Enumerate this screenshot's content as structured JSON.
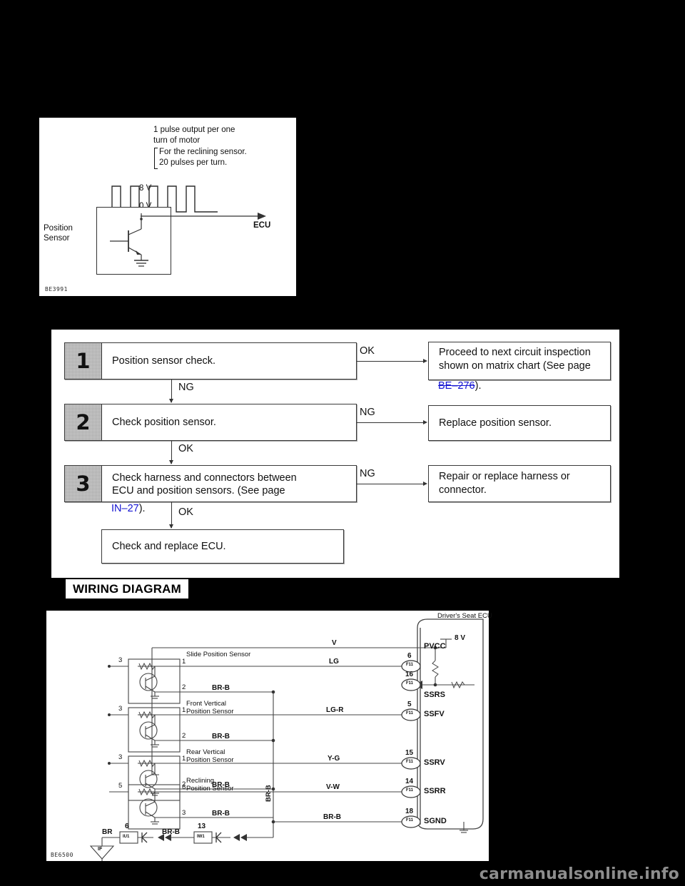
{
  "figure_top": {
    "code": "BE3991",
    "note_main": "1 pulse output per one\nturn of motor",
    "note_sub": "For the reclining sensor.\n20 pulses per turn.",
    "voltage_high": "8 V",
    "voltage_low": "0 V",
    "sensor_label": "Position\nSensor",
    "output_label": "ECU",
    "pulse_count": 5
  },
  "flowchart": {
    "steps": [
      {
        "number": "1",
        "text": "Position sensor check.",
        "branch_label": "OK",
        "down_label": "NG",
        "result": {
          "line1": "Proceed to next circuit inspection",
          "line2": "shown on matrix chart (See page",
          "link": "BE–276",
          "link_suffix": ")."
        }
      },
      {
        "number": "2",
        "text": "Check position sensor.",
        "branch_label": "NG",
        "down_label": "OK",
        "result": {
          "line1": "Replace position sensor."
        }
      },
      {
        "number": "3",
        "text_line1": "Check harness and connectors between",
        "text_line2": "ECU and position sensors.  (See page",
        "link": "IN–27",
        "link_suffix": ").",
        "branch_label": "NG",
        "down_label": "OK",
        "result": {
          "line1": "Repair or replace harness or",
          "line2": "connector."
        }
      }
    ],
    "final_box": "Check and replace ECU."
  },
  "wiring": {
    "heading": "WIRING DIAGRAM",
    "code": "BE6500",
    "ecu_title": "Driver's Seat ECU",
    "supply_label": "8 V",
    "sensors": [
      {
        "name": "Slide Position Sensor",
        "pin_left": "3",
        "pin_top": "1",
        "pin_bottom": "2",
        "ground_wire": "BR-B",
        "signal_wire": "LG"
      },
      {
        "name": "Front Vertical\nPosition Sensor",
        "pin_left": "3",
        "pin_top": "1",
        "pin_bottom": "2",
        "ground_wire": "BR-B",
        "signal_wire": "LG-R"
      },
      {
        "name": "Rear Vertical\nPosition Sensor",
        "pin_left": "3",
        "pin_top": "1",
        "pin_bottom": "2",
        "ground_wire": "BR-B",
        "signal_wire": "Y-G"
      },
      {
        "name": "Reclining\nPosition Sensor",
        "pin_left": "5",
        "pin_top": "6",
        "pin_bottom": "3",
        "ground_wire": "BR-B",
        "signal_wire": "V-W"
      }
    ],
    "ecu_pins": [
      {
        "number": "6",
        "name": "PVCC",
        "wire": "V",
        "connector": "F11"
      },
      {
        "number": "16",
        "name": "SSRS",
        "wire": "LG",
        "connector": "F11"
      },
      {
        "number": "5",
        "name": "SSFV",
        "wire": "LG-R",
        "connector": "F11"
      },
      {
        "number": "15",
        "name": "SSRV",
        "wire": "Y-G",
        "connector": "F11"
      },
      {
        "number": "14",
        "name": "SSRR",
        "wire": "V-W",
        "connector": "F11"
      },
      {
        "number": "18",
        "name": "SGND",
        "wire": "BR-B",
        "connector": "F11"
      }
    ],
    "ground_path": {
      "vertical_wire": "BR-B",
      "connector_a_number": "13",
      "connector_a_name": "IW1",
      "mid_wire": "BR-B",
      "connector_b_number": "6",
      "connector_b_name": "IU1",
      "final_wire": "BR",
      "ground_symbol": "IF"
    }
  },
  "watermark": "carmanualsonline.info"
}
